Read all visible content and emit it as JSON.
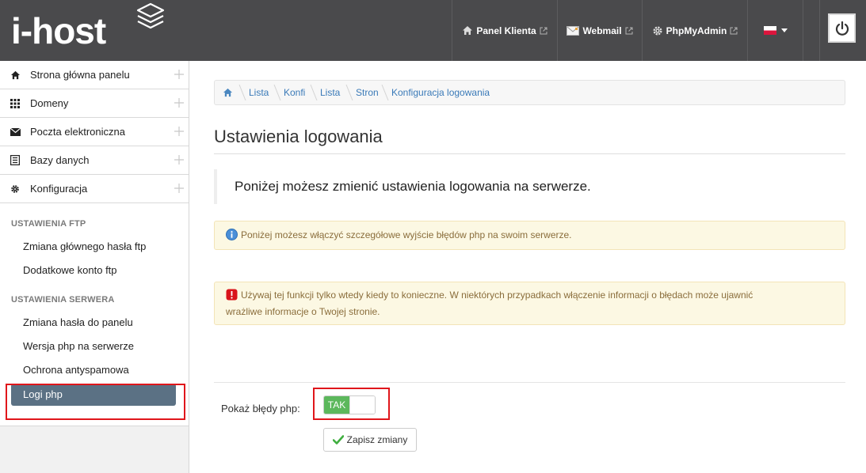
{
  "header": {
    "logo_text": "i-host",
    "nav": [
      {
        "label": "Panel Klienta",
        "icon": "home-icon"
      },
      {
        "label": "Webmail",
        "icon": "mail-icon"
      },
      {
        "label": "PhpMyAdmin",
        "icon": "gear-icon"
      }
    ],
    "language_icon": "poland-flag-icon",
    "power_icon": "power-icon"
  },
  "sidebar": {
    "menu": [
      {
        "label": "Strona główna panelu",
        "icon": "home-icon"
      },
      {
        "label": "Domeny",
        "icon": "grid-icon"
      },
      {
        "label": "Poczta elektroniczna",
        "icon": "envelope-icon"
      },
      {
        "label": "Bazy danych",
        "icon": "list-icon"
      },
      {
        "label": "Konfiguracja",
        "icon": "gear-icon"
      }
    ],
    "sections": [
      {
        "heading": "USTAWIENIA FTP",
        "items": [
          "Zmiana głównego hasła ftp",
          "Dodatkowe konto ftp"
        ]
      },
      {
        "heading": "USTAWIENIA SERWERA",
        "items": [
          "Zmiana hasła do panelu",
          "Wersja php na serwerze",
          "Ochrona antyspamowa",
          "Logi php"
        ]
      }
    ],
    "active_item": "Logi php"
  },
  "breadcrumb": {
    "items": [
      "Lista d",
      "Konfi",
      "Lista l",
      "Stron",
      "Konfiguracja logowania"
    ]
  },
  "main": {
    "title": "Ustawienia logowania",
    "lead": "Poniżej możesz zmienić ustawienia logowania na serwerze.",
    "info_alert": "Poniżej możesz włączyć szczegółowe wyjście błędów php na swoim serwerze.",
    "warning_alert_line1": "Używaj tej funkcji tylko wtedy kiedy to konieczne. W niektórych przypadkach włączenie informacji o błędach może ujawnić",
    "warning_alert_line2": "wrażliwe informacje o Twojej stronie.",
    "form": {
      "label": "Pokaż błędy php:",
      "toggle_label": "TAK",
      "toggle_on": true,
      "save_label": "Zapisz zmiany"
    }
  },
  "colors": {
    "topbar": "#4a4a4c",
    "active_item": "#5b7184",
    "highlight": "#e0161b",
    "toggle_on": "#5cb85c",
    "alert_bg": "#fcf8e3"
  }
}
